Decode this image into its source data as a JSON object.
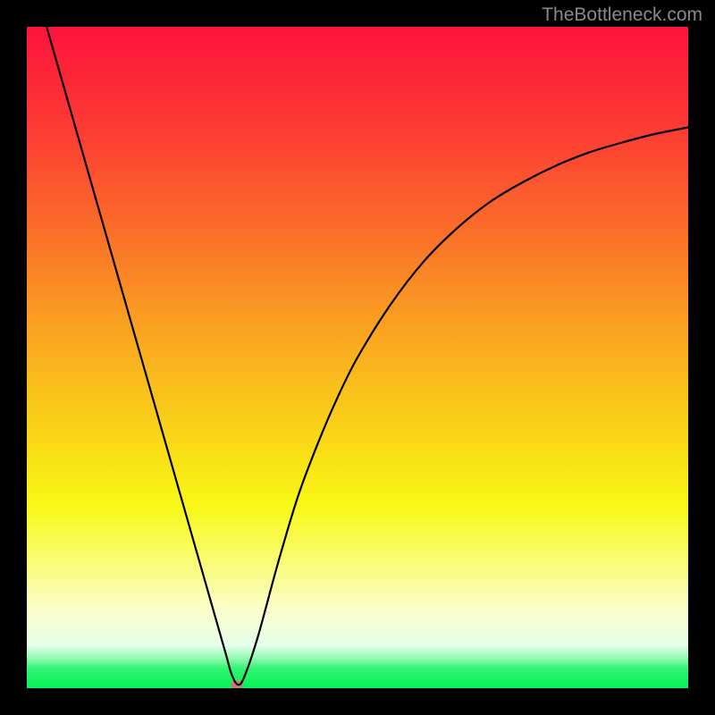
{
  "watermark": "TheBottleneck.com",
  "chart_data": {
    "type": "line",
    "title": "",
    "xlabel": "",
    "ylabel": "",
    "xlim": [
      0,
      100
    ],
    "ylim": [
      0,
      100
    ],
    "grid": false,
    "legend": false,
    "gradient_stops": [
      {
        "pos": 0.0,
        "color": "#fd133c"
      },
      {
        "pos": 0.15,
        "color": "#fc3a33"
      },
      {
        "pos": 0.3,
        "color": "#fb6b2a"
      },
      {
        "pos": 0.45,
        "color": "#faa121"
      },
      {
        "pos": 0.6,
        "color": "#f9d018"
      },
      {
        "pos": 0.72,
        "color": "#f8f713"
      },
      {
        "pos": 0.78,
        "color": "#f9fb53"
      },
      {
        "pos": 0.88,
        "color": "#fbfec9"
      },
      {
        "pos": 0.935,
        "color": "#e6feeb"
      },
      {
        "pos": 0.955,
        "color": "#92fab0"
      },
      {
        "pos": 0.97,
        "color": "#33f574"
      },
      {
        "pos": 1.0,
        "color": "#04f254"
      }
    ],
    "series": [
      {
        "name": "bottleneck-curve",
        "color": "#000000",
        "x": [
          3,
          6,
          9,
          12,
          15,
          18,
          21,
          24,
          27,
          30,
          31,
          32,
          33,
          35,
          38,
          41,
          44,
          47,
          50,
          55,
          60,
          65,
          70,
          75,
          80,
          85,
          90,
          95,
          100
        ],
        "y": [
          100,
          89.5,
          79,
          68.5,
          58,
          47.5,
          37,
          26.5,
          16,
          5.5,
          2,
          0.5,
          2,
          8,
          19,
          29,
          37,
          44,
          50,
          58,
          64.5,
          69.5,
          73.5,
          76.5,
          79,
          81,
          82.5,
          83.8,
          84.8
        ]
      }
    ],
    "marker": {
      "x": 31.8,
      "y": 0.5,
      "color": "#c77a76"
    }
  }
}
